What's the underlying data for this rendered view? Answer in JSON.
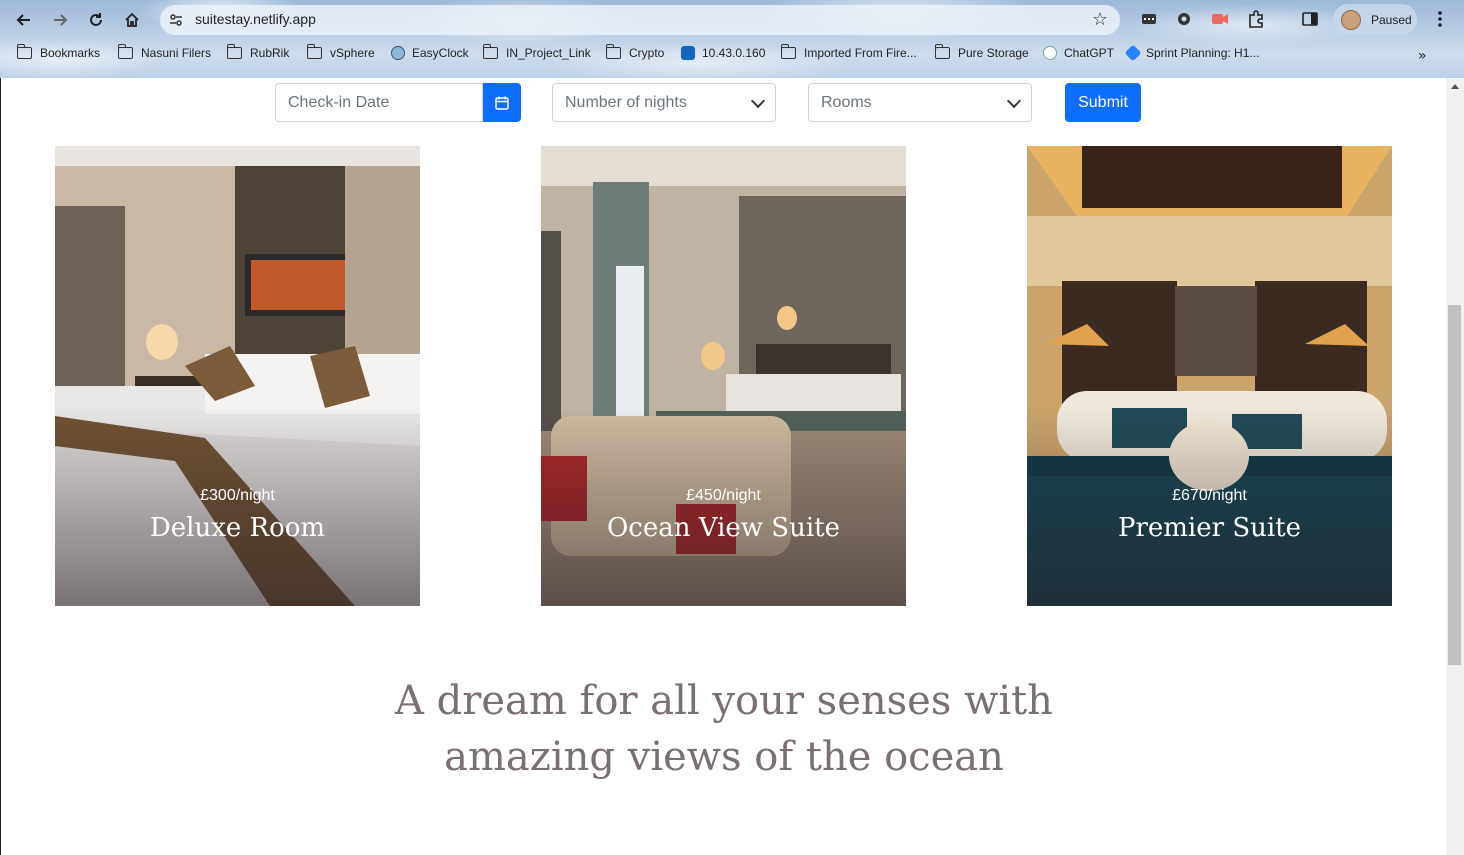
{
  "browser": {
    "url": "suitestay.netlify.app",
    "profile_label": "Paused",
    "bookmarks": [
      {
        "label": "Bookmarks",
        "icon": "folder-icon"
      },
      {
        "label": "Nasuni Filers",
        "icon": "folder-icon"
      },
      {
        "label": "RubRik",
        "icon": "folder-icon"
      },
      {
        "label": "vSphere",
        "icon": "folder-icon"
      },
      {
        "label": "EasyClock",
        "icon": "clock-icon"
      },
      {
        "label": "IN_Project_Link",
        "icon": "folder-icon"
      },
      {
        "label": "Crypto",
        "icon": "folder-icon"
      },
      {
        "label": "10.43.0.160",
        "icon": "q-icon"
      },
      {
        "label": "Imported From Fire...",
        "icon": "folder-icon"
      },
      {
        "label": "Pure Storage",
        "icon": "folder-icon"
      },
      {
        "label": "ChatGPT",
        "icon": "chatgpt-icon"
      },
      {
        "label": "Sprint Planning: H1...",
        "icon": "jira-icon"
      }
    ]
  },
  "booking": {
    "checkin_placeholder": "Check-in Date",
    "nights_placeholder": "Number of nights",
    "rooms_placeholder": "Rooms",
    "submit_label": "Submit"
  },
  "rooms": [
    {
      "price": "£300/night",
      "name": "Deluxe Room"
    },
    {
      "price": "£450/night",
      "name": "Ocean View Suite"
    },
    {
      "price": "£670/night",
      "name": "Premier Suite"
    }
  ],
  "tagline": {
    "line1": "A dream for all your senses with",
    "line2": "amazing views of the ocean"
  },
  "colors": {
    "primary": "#0d6efd",
    "tagline": "#7a7072"
  }
}
